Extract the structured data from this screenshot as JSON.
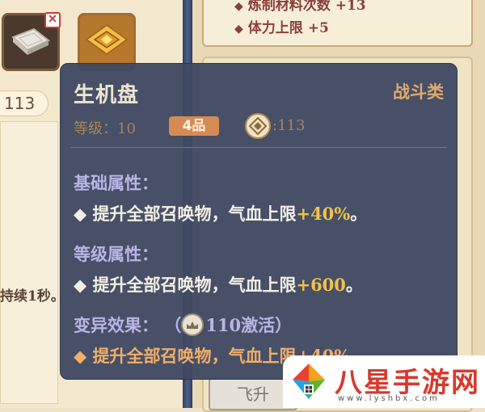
{
  "background": {
    "left_number": "113",
    "left_duration_text": "持续1秒。",
    "right_stats": [
      {
        "text": "炼制材料次数 +13"
      },
      {
        "text": "体力上限 +5"
      }
    ],
    "bottom_tab_label": "飞升"
  },
  "tooltip": {
    "name": "生机盘",
    "type": "战斗类",
    "level_label": "等级：10",
    "grade_badge": "4品",
    "medal_value": ":113",
    "base_section": {
      "title": "基础属性：",
      "line_prefix": "◆ 提升全部召唤物，气血上限",
      "line_value": "+40%",
      "line_suffix": "。"
    },
    "level_section": {
      "title": "等级属性：",
      "line_prefix": "◆ 提升全部召唤物，气血上限",
      "line_value": "+600",
      "line_suffix": "。"
    },
    "mutation_section": {
      "title": "变异效果：",
      "activate_open": "（",
      "activate_text": "110激活）",
      "line_text": "◆ 提升全部召唤物，气血上限+40%"
    }
  },
  "watermark": {
    "title": "八星手游网",
    "url": "www.lyshbx.com"
  },
  "colors": {
    "tooltip_bg": "#3f4a62",
    "section_title": "#b9b4e6",
    "highlight_value": "#f3c14a",
    "type_label": "#e0aa6c",
    "grade_badge": "#d78b54",
    "mutation_text": "#f1ad6a"
  },
  "icons": [
    "close-icon",
    "stone-tablet-icon",
    "golden-disc-icon",
    "medal-icon",
    "activate-crown-icon",
    "diamond-bullet-icon"
  ]
}
